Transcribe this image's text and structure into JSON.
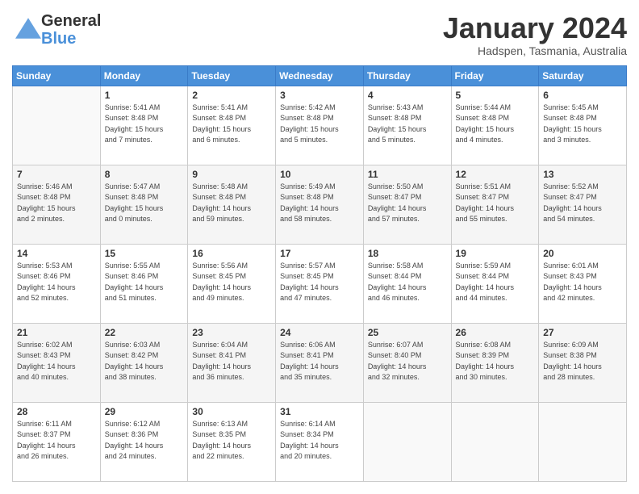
{
  "header": {
    "logo_general": "General",
    "logo_blue": "Blue",
    "month_title": "January 2024",
    "location": "Hadspen, Tasmania, Australia"
  },
  "weekdays": [
    "Sunday",
    "Monday",
    "Tuesday",
    "Wednesday",
    "Thursday",
    "Friday",
    "Saturday"
  ],
  "weeks": [
    [
      {
        "day": "",
        "info": ""
      },
      {
        "day": "1",
        "info": "Sunrise: 5:41 AM\nSunset: 8:48 PM\nDaylight: 15 hours\nand 7 minutes."
      },
      {
        "day": "2",
        "info": "Sunrise: 5:41 AM\nSunset: 8:48 PM\nDaylight: 15 hours\nand 6 minutes."
      },
      {
        "day": "3",
        "info": "Sunrise: 5:42 AM\nSunset: 8:48 PM\nDaylight: 15 hours\nand 5 minutes."
      },
      {
        "day": "4",
        "info": "Sunrise: 5:43 AM\nSunset: 8:48 PM\nDaylight: 15 hours\nand 5 minutes."
      },
      {
        "day": "5",
        "info": "Sunrise: 5:44 AM\nSunset: 8:48 PM\nDaylight: 15 hours\nand 4 minutes."
      },
      {
        "day": "6",
        "info": "Sunrise: 5:45 AM\nSunset: 8:48 PM\nDaylight: 15 hours\nand 3 minutes."
      }
    ],
    [
      {
        "day": "7",
        "info": "Sunrise: 5:46 AM\nSunset: 8:48 PM\nDaylight: 15 hours\nand 2 minutes."
      },
      {
        "day": "8",
        "info": "Sunrise: 5:47 AM\nSunset: 8:48 PM\nDaylight: 15 hours\nand 0 minutes."
      },
      {
        "day": "9",
        "info": "Sunrise: 5:48 AM\nSunset: 8:48 PM\nDaylight: 14 hours\nand 59 minutes."
      },
      {
        "day": "10",
        "info": "Sunrise: 5:49 AM\nSunset: 8:48 PM\nDaylight: 14 hours\nand 58 minutes."
      },
      {
        "day": "11",
        "info": "Sunrise: 5:50 AM\nSunset: 8:47 PM\nDaylight: 14 hours\nand 57 minutes."
      },
      {
        "day": "12",
        "info": "Sunrise: 5:51 AM\nSunset: 8:47 PM\nDaylight: 14 hours\nand 55 minutes."
      },
      {
        "day": "13",
        "info": "Sunrise: 5:52 AM\nSunset: 8:47 PM\nDaylight: 14 hours\nand 54 minutes."
      }
    ],
    [
      {
        "day": "14",
        "info": "Sunrise: 5:53 AM\nSunset: 8:46 PM\nDaylight: 14 hours\nand 52 minutes."
      },
      {
        "day": "15",
        "info": "Sunrise: 5:55 AM\nSunset: 8:46 PM\nDaylight: 14 hours\nand 51 minutes."
      },
      {
        "day": "16",
        "info": "Sunrise: 5:56 AM\nSunset: 8:45 PM\nDaylight: 14 hours\nand 49 minutes."
      },
      {
        "day": "17",
        "info": "Sunrise: 5:57 AM\nSunset: 8:45 PM\nDaylight: 14 hours\nand 47 minutes."
      },
      {
        "day": "18",
        "info": "Sunrise: 5:58 AM\nSunset: 8:44 PM\nDaylight: 14 hours\nand 46 minutes."
      },
      {
        "day": "19",
        "info": "Sunrise: 5:59 AM\nSunset: 8:44 PM\nDaylight: 14 hours\nand 44 minutes."
      },
      {
        "day": "20",
        "info": "Sunrise: 6:01 AM\nSunset: 8:43 PM\nDaylight: 14 hours\nand 42 minutes."
      }
    ],
    [
      {
        "day": "21",
        "info": "Sunrise: 6:02 AM\nSunset: 8:43 PM\nDaylight: 14 hours\nand 40 minutes."
      },
      {
        "day": "22",
        "info": "Sunrise: 6:03 AM\nSunset: 8:42 PM\nDaylight: 14 hours\nand 38 minutes."
      },
      {
        "day": "23",
        "info": "Sunrise: 6:04 AM\nSunset: 8:41 PM\nDaylight: 14 hours\nand 36 minutes."
      },
      {
        "day": "24",
        "info": "Sunrise: 6:06 AM\nSunset: 8:41 PM\nDaylight: 14 hours\nand 35 minutes."
      },
      {
        "day": "25",
        "info": "Sunrise: 6:07 AM\nSunset: 8:40 PM\nDaylight: 14 hours\nand 32 minutes."
      },
      {
        "day": "26",
        "info": "Sunrise: 6:08 AM\nSunset: 8:39 PM\nDaylight: 14 hours\nand 30 minutes."
      },
      {
        "day": "27",
        "info": "Sunrise: 6:09 AM\nSunset: 8:38 PM\nDaylight: 14 hours\nand 28 minutes."
      }
    ],
    [
      {
        "day": "28",
        "info": "Sunrise: 6:11 AM\nSunset: 8:37 PM\nDaylight: 14 hours\nand 26 minutes."
      },
      {
        "day": "29",
        "info": "Sunrise: 6:12 AM\nSunset: 8:36 PM\nDaylight: 14 hours\nand 24 minutes."
      },
      {
        "day": "30",
        "info": "Sunrise: 6:13 AM\nSunset: 8:35 PM\nDaylight: 14 hours\nand 22 minutes."
      },
      {
        "day": "31",
        "info": "Sunrise: 6:14 AM\nSunset: 8:34 PM\nDaylight: 14 hours\nand 20 minutes."
      },
      {
        "day": "",
        "info": ""
      },
      {
        "day": "",
        "info": ""
      },
      {
        "day": "",
        "info": ""
      }
    ]
  ]
}
